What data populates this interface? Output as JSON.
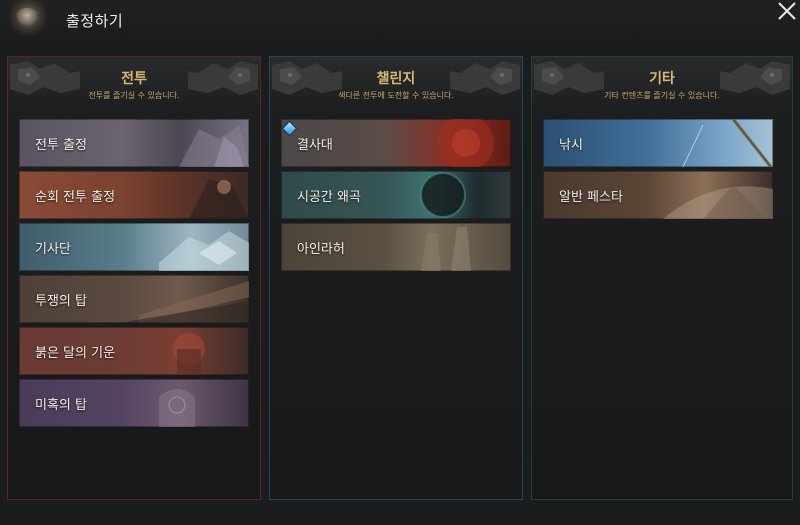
{
  "window": {
    "title": "출정하기"
  },
  "panels": {
    "battle": {
      "title": "전투",
      "subtitle": "전투를 즐기실 수 있습니다.",
      "items": [
        {
          "label": "전투 출정"
        },
        {
          "label": "순회 전투 출정"
        },
        {
          "label": "기사단"
        },
        {
          "label": "투쟁의 탑"
        },
        {
          "label": "붉은 달의 기운"
        },
        {
          "label": "미혹의 탑"
        }
      ]
    },
    "challenge": {
      "title": "챌린지",
      "subtitle": "색다른 전투에 도전할 수 있습니다.",
      "items": [
        {
          "label": "결사대",
          "badge": "diamond-icon"
        },
        {
          "label": "시공간 왜곡"
        },
        {
          "label": "아인라허"
        }
      ]
    },
    "other": {
      "title": "기타",
      "subtitle": "기타 컨텐츠를 즐기실 수 있습니다.",
      "items": [
        {
          "label": "낚시"
        },
        {
          "label": "알반 페스타"
        }
      ]
    }
  },
  "colors": {
    "battle_border": "#5c2327",
    "challenge_border": "#1f4a52",
    "other_border": "#23452d",
    "header_gold": "#d9b877"
  }
}
